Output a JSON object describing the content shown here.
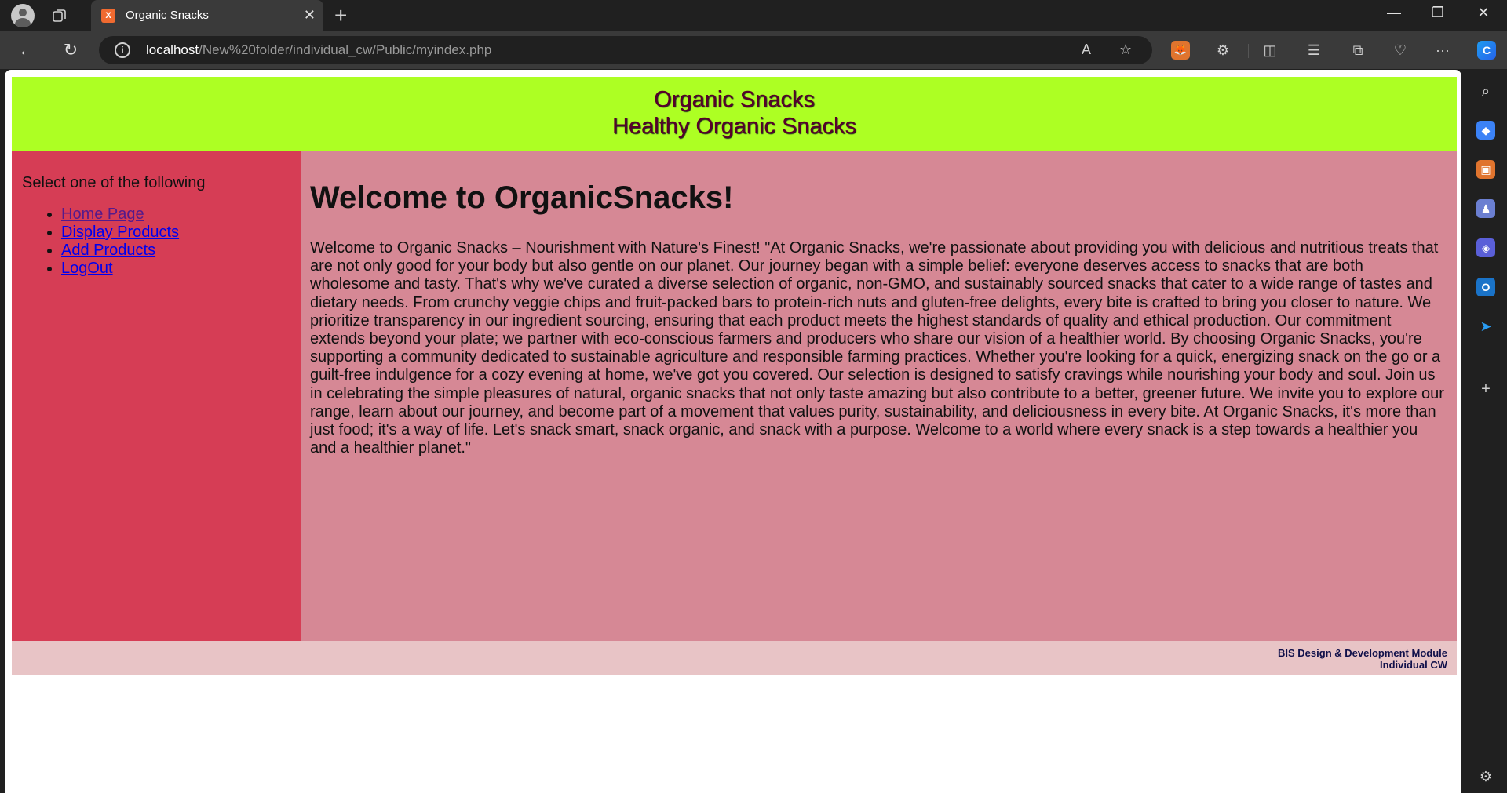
{
  "browser": {
    "tab_title": "Organic Snacks",
    "tab_favicon": "X",
    "url_host": "localhost",
    "url_path": "/New%20folder/individual_cw/Public/myindex.php"
  },
  "site": {
    "header_line1": "Organic Snacks",
    "header_line2": "Healthy Organic Snacks",
    "nav_prompt": "Select one of the following",
    "nav_links": [
      "Home Page",
      "Display Products",
      "Add Products",
      "LogOut"
    ],
    "heading": "Welcome to OrganicSnacks!",
    "body": "Welcome to Organic Snacks – Nourishment with Nature's Finest! \"At Organic Snacks, we're passionate about providing you with delicious and nutritious treats that are not only good for your body but also gentle on our planet. Our journey began with a simple belief: everyone deserves access to snacks that are both wholesome and tasty. That's why we've curated a diverse selection of organic, non-GMO, and sustainably sourced snacks that cater to a wide range of tastes and dietary needs. From crunchy veggie chips and fruit-packed bars to protein-rich nuts and gluten-free delights, every bite is crafted to bring you closer to nature. We prioritize transparency in our ingredient sourcing, ensuring that each product meets the highest standards of quality and ethical production. Our commitment extends beyond your plate; we partner with eco-conscious farmers and producers who share our vision of a healthier world. By choosing Organic Snacks, you're supporting a community dedicated to sustainable agriculture and responsible farming practices. Whether you're looking for a quick, energizing snack on the go or a guilt-free indulgence for a cozy evening at home, we've got you covered. Our selection is designed to satisfy cravings while nourishing your body and soul. Join us in celebrating the simple pleasures of natural, organic snacks that not only taste amazing but also contribute to a better, greener future. We invite you to explore our range, learn about our journey, and become part of a movement that values purity, sustainability, and deliciousness in every bite. At Organic Snacks, it's more than just food; it's a way of life. Let's snack smart, snack organic, and snack with a purpose. Welcome to a world where every snack is a step towards a healthier you and a healthier planet.\"",
    "footer_line1": "BIS Design & Development Module",
    "footer_line2": "Individual CW"
  },
  "colors": {
    "header_bg": "#adff23",
    "nav_bg": "#d63d55",
    "main_bg": "#d68895",
    "footer_bg": "#e8c4c6"
  }
}
